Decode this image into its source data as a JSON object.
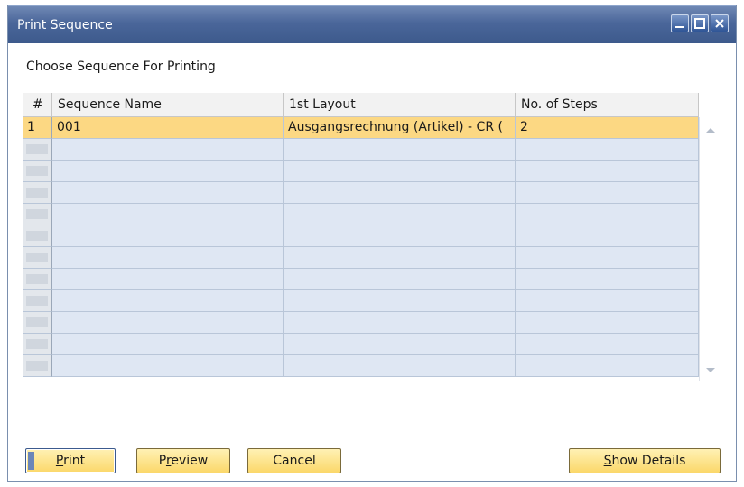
{
  "window": {
    "title": "Print Sequence"
  },
  "form": {
    "choose_label": "Choose Sequence For Printing"
  },
  "table": {
    "columns": [
      "#",
      "Sequence Name",
      "1st Layout",
      "No. of Steps"
    ],
    "rows": [
      {
        "num": "1",
        "sequence_name": "001",
        "first_layout": "Ausgangsrechnung (Artikel) - CR (",
        "steps": "2",
        "selected": true
      }
    ],
    "empty_row_count": 11
  },
  "buttons": {
    "print": {
      "hot": "P",
      "rest": "rint"
    },
    "preview": {
      "pre": "P",
      "hot": "r",
      "rest": "eview"
    },
    "cancel": "Cancel",
    "show_details": {
      "hot": "S",
      "rest": "how Details"
    }
  },
  "colors": {
    "titlebar": "#4a669a",
    "selected_row": "#fcd883",
    "grid_row": "#dfe7f3",
    "button": "#fbd86a"
  },
  "icons": [
    "minimize-icon",
    "maximize-icon",
    "close-icon",
    "scroll-up-icon",
    "scroll-down-icon"
  ]
}
